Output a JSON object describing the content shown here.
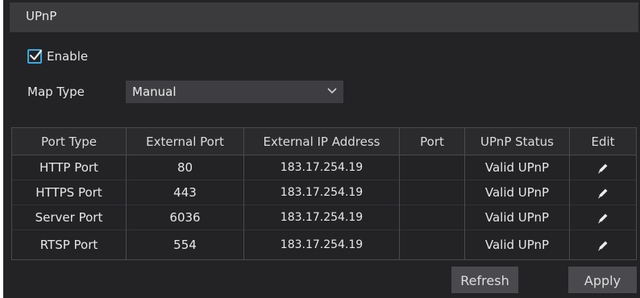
{
  "title": "UPnP",
  "enable": {
    "label": "Enable",
    "checked": true
  },
  "map_type": {
    "label": "Map Type",
    "value": "Manual"
  },
  "table": {
    "headers": [
      "Port Type",
      "External Port",
      "External IP Address",
      "Port",
      "UPnP Status",
      "Edit"
    ],
    "rows": [
      {
        "port_type": "HTTP Port",
        "external_port": "80",
        "external_ip": "183.17.254.19",
        "port": "",
        "status": "Valid UPnP"
      },
      {
        "port_type": "HTTPS Port",
        "external_port": "443",
        "external_ip": "183.17.254.19",
        "port": "",
        "status": "Valid UPnP"
      },
      {
        "port_type": "Server Port",
        "external_port": "6036",
        "external_ip": "183.17.254.19",
        "port": "",
        "status": "Valid UPnP"
      },
      {
        "port_type": "RTSP Port",
        "external_port": "554",
        "external_ip": "183.17.254.19",
        "port": "",
        "status": "Valid UPnP"
      }
    ]
  },
  "buttons": {
    "refresh": "Refresh",
    "apply": "Apply"
  },
  "icons": {
    "checkbox": "checkmark-icon",
    "dropdown": "chevron-down-icon",
    "edit": "pencil-icon"
  },
  "colors": {
    "accent": "#3aa8e0",
    "panel_bg": "#232326",
    "titlebar_bg": "#3b3b3e"
  }
}
